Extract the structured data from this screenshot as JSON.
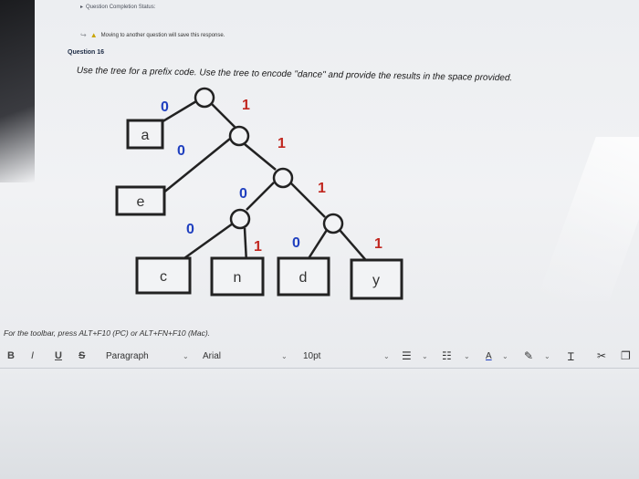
{
  "header": {
    "status_text": "Question Completion Status:",
    "warning_text": "Moving to another question will save this response."
  },
  "question": {
    "label": "Question 16",
    "prompt": "Use the tree for a prefix code. Use the tree to encode \"dance\" and provide the results in the space provided."
  },
  "tree": {
    "leaves": [
      "a",
      "e",
      "c",
      "n",
      "d",
      "y"
    ],
    "edge_zero": "0",
    "edge_one": "1",
    "colors": {
      "zero": "#1f3fbf",
      "one": "#c1271f"
    }
  },
  "editor": {
    "toolbar_hint": "For the toolbar, press ALT+F10 (PC) or ALT+FN+F10 (Mac).",
    "bold": "B",
    "italic": "I",
    "underline": "U",
    "strike": "S",
    "block_format": "Paragraph",
    "font_family": "Arial",
    "font_size": "10pt",
    "text_color": "A"
  }
}
